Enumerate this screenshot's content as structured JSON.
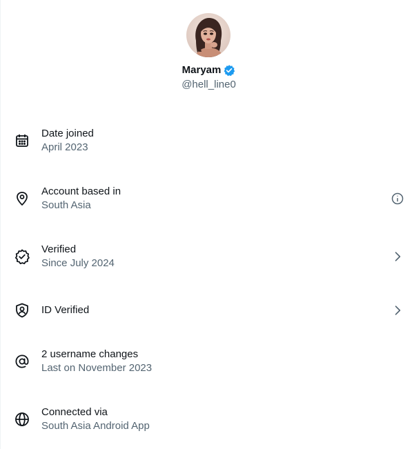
{
  "profile": {
    "display_name": "Maryam",
    "handle": "@hell_line0",
    "verified_badge_color": "#1d9bf0"
  },
  "rows": [
    {
      "icon": "calendar-icon",
      "title": "Date joined",
      "subtitle": "April 2023",
      "trailing": null
    },
    {
      "icon": "location-pin-icon",
      "title": "Account based in",
      "subtitle": "South Asia",
      "trailing": "info-icon"
    },
    {
      "icon": "verified-check-icon",
      "title": "Verified",
      "subtitle": "Since July 2024",
      "trailing": "chevron-right-icon"
    },
    {
      "icon": "id-shield-icon",
      "title": "ID Verified",
      "subtitle": "",
      "trailing": "chevron-right-icon"
    },
    {
      "icon": "at-sign-icon",
      "title": "2 username changes",
      "subtitle": "Last on November 2023",
      "trailing": null
    },
    {
      "icon": "globe-icon",
      "title": "Connected via",
      "subtitle": "South Asia Android App",
      "trailing": null
    }
  ],
  "colors": {
    "primary_text": "#0f1419",
    "secondary_text": "#536471",
    "divider": "#eff3f4"
  }
}
